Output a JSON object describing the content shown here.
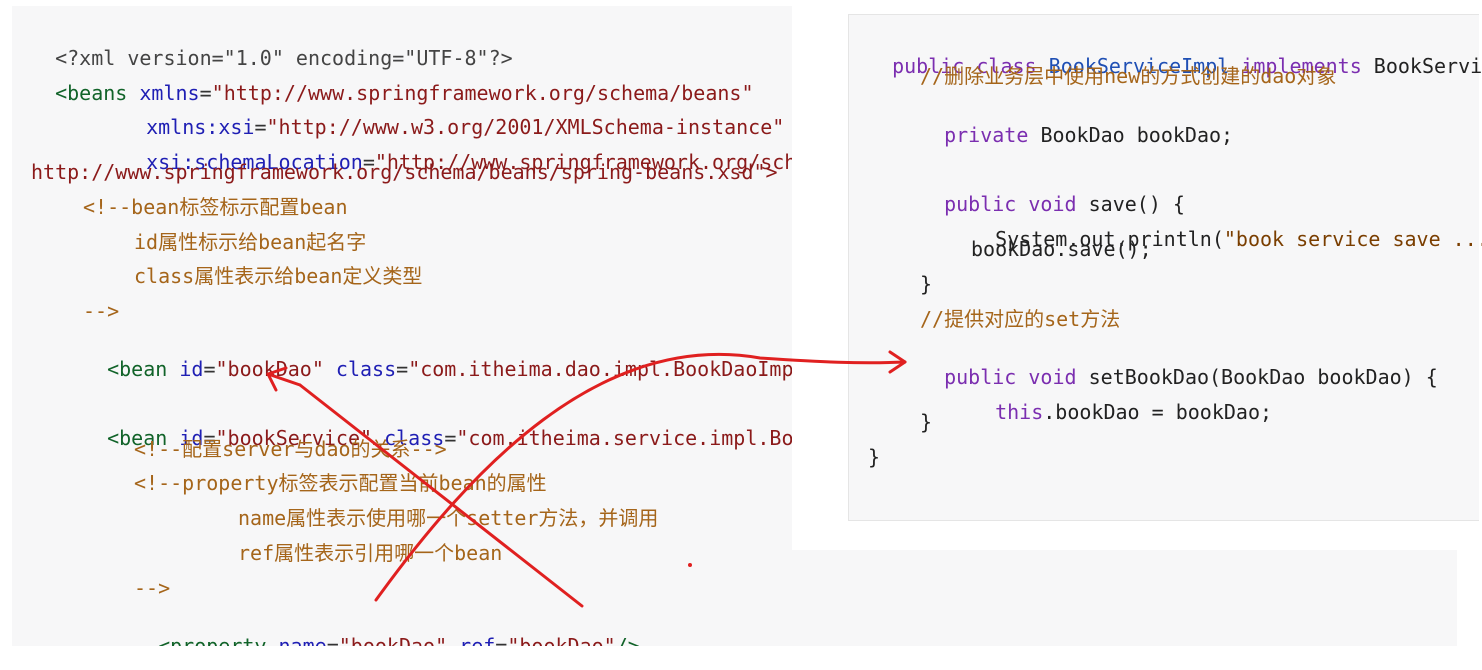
{
  "left_code": {
    "xml_decl": "<?xml version=\"1.0\" encoding=\"UTF-8\"?>",
    "beans_open_tag": "<beans",
    "xmlns_attr": "xmlns",
    "xmlns_val": "\"http://www.springframework.org/schema/beans\"",
    "xmlns_xsi_attr": "xmlns:xsi",
    "xmlns_xsi_val": "\"http://www.w3.org/2001/XMLSchema-instance\"",
    "schema_attr": "xsi:schemaLocation",
    "schema_val": "\"http://www.springframework.org/schema/beans",
    "schema_url2": "http://www.springframework.org/schema/beans/spring-beans.xsd\">",
    "c1": "<!--bean标签标示配置bean",
    "c2": "id属性标示给bean起名字",
    "c3": "class属性表示给bean定义类型",
    "c4": "-->",
    "bean1_tag": "<bean",
    "bean1_id_attr": "id",
    "bean1_id_val": "\"bookDao\"",
    "bean1_class_attr": "class",
    "bean1_class_val": "\"com.itheima.dao.impl.BookDaoImpl\"/>",
    "bean2_tag": "<bean",
    "bean2_id_attr": "id",
    "bean2_id_val": "\"bookService\"",
    "bean2_class_attr": "class",
    "bean2_class_val": "\"com.itheima.service.impl.BookServiceImpl\">",
    "c5": "<!--配置server与dao的关系-->",
    "c6": "<!--property标签表示配置当前bean的属性",
    "c7": "name属性表示使用哪一个setter方法，并调用",
    "c8": "ref属性表示引用哪一个bean",
    "c9": "-->",
    "prop_tag": "<property",
    "prop_name_attr": "name",
    "prop_name_val": "\"bookDao\"",
    "prop_ref_attr": "ref",
    "prop_ref_val": "\"bookDao\"",
    "prop_close": "/>"
  },
  "right_code": {
    "l1_public": "public",
    "l1_class": "class",
    "l1_name": "BookServiceImpl",
    "l1_impl": "implements",
    "l1_iface": "BookService {",
    "l2_comment": "//删除业务层中使用new的方式创建的dao对象",
    "l3_private": "private",
    "l3_rest": "BookDao bookDao;",
    "l5_public": "public",
    "l5_void": "void",
    "l5_rest": "save() {",
    "l6_sys": "System.out.println(",
    "l6_str": "\"book service save ...\");",
    "l7": "bookDao.save();",
    "l8": "}",
    "l9_comment": "//提供对应的set方法",
    "l10_public": "public",
    "l10_void": "void",
    "l10_rest": "setBookDao(BookDao bookDao) {",
    "l11_this": "this",
    "l11_rest": ".bookDao = bookDao;",
    "l12": "}",
    "l13": "}"
  },
  "annotations": {
    "cross_color": "#e02020",
    "arrow_color": "#e02020"
  }
}
